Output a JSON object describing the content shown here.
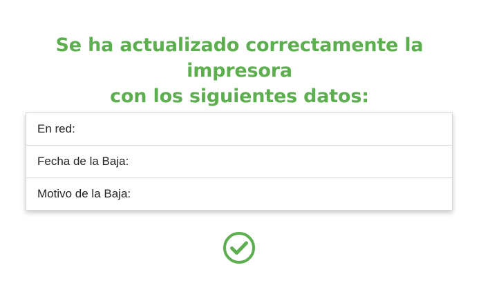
{
  "message": {
    "title_line1": "Se ha actualizado correctamente la impresora",
    "title_line2": "con los siguientes datos:"
  },
  "details": [
    {
      "label": "En red:",
      "value": ""
    },
    {
      "label": "Fecha de la Baja:",
      "value": ""
    },
    {
      "label": "Motivo de la Baja:",
      "value": ""
    }
  ],
  "status": {
    "icon": "check-circle-icon",
    "color": "#5cae4f"
  }
}
